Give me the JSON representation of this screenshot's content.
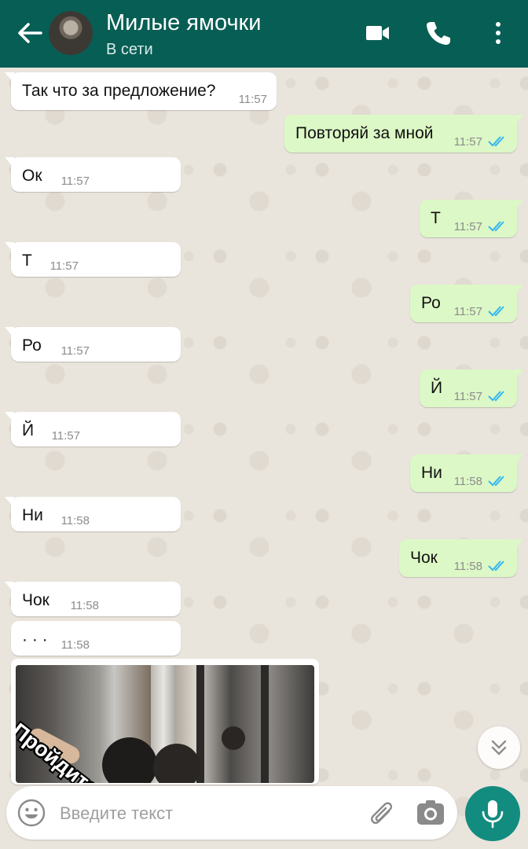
{
  "header": {
    "contact_name": "Милые ямочки",
    "status": "В сети",
    "back_icon": "arrow-left-icon",
    "video_icon": "video-camera-icon",
    "call_icon": "phone-icon",
    "menu_icon": "more-vert-icon"
  },
  "messages": [
    {
      "dir": "in",
      "text": "Так что за предложение?",
      "time": "11:57"
    },
    {
      "dir": "out",
      "text": "Повторяй за мной",
      "time": "11:57",
      "read": true
    },
    {
      "dir": "in",
      "text": "Ок",
      "time": "11:57"
    },
    {
      "dir": "out",
      "text": "Т",
      "time": "11:57",
      "read": true
    },
    {
      "dir": "in",
      "text": "Т",
      "time": "11:57"
    },
    {
      "dir": "out",
      "text": "Ро",
      "time": "11:57",
      "read": true
    },
    {
      "dir": "in",
      "text": "Ро",
      "time": "11:57"
    },
    {
      "dir": "out",
      "text": "Й",
      "time": "11:57",
      "read": true
    },
    {
      "dir": "in",
      "text": "Й",
      "time": "11:57"
    },
    {
      "dir": "out",
      "text": "Ни",
      "time": "11:58",
      "read": true
    },
    {
      "dir": "in",
      "text": "Ни",
      "time": "11:58"
    },
    {
      "dir": "out",
      "text": "Чок",
      "time": "11:58",
      "read": true
    },
    {
      "dir": "in",
      "text": "Чок",
      "time": "11:58"
    },
    {
      "dir": "in",
      "text": "· · ·",
      "time": "11:58"
    }
  ],
  "image_message": {
    "caption": "Пройдите"
  },
  "composer": {
    "placeholder": "Введите текст",
    "emoji_icon": "emoji-icon",
    "attach_icon": "paperclip-icon",
    "camera_icon": "camera-icon",
    "mic_icon": "microphone-icon"
  },
  "scroll_icon": "chevrons-down-icon",
  "colors": {
    "header": "#075e54",
    "outgoing_bubble": "#dcf8c6",
    "incoming_bubble": "#ffffff",
    "read_ticks": "#34b7f1",
    "mic_button": "#128c7e"
  }
}
